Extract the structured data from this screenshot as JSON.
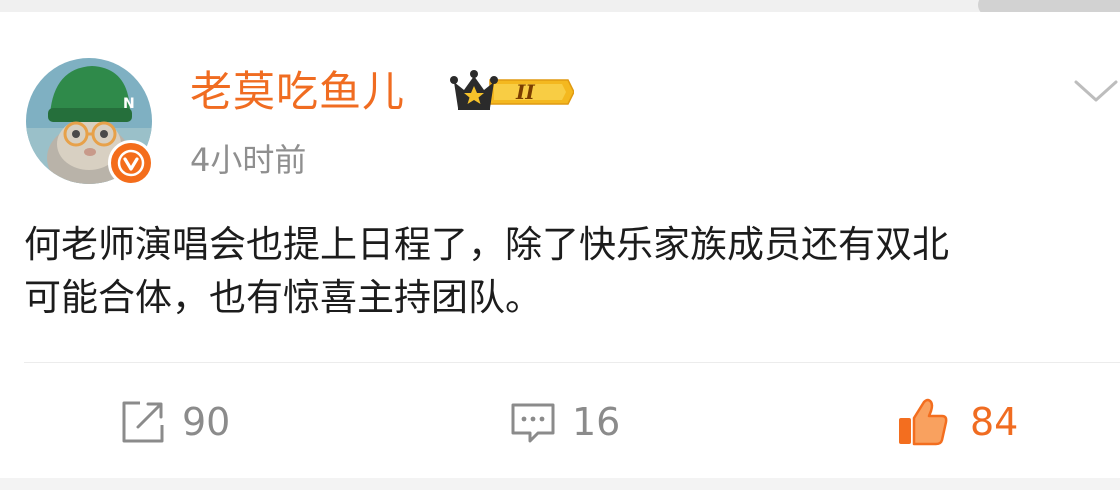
{
  "post": {
    "author": {
      "name": "老莫吃鱼儿",
      "vip_level": "II"
    },
    "time": "4小时前",
    "content_lines": [
      "何老师演唱会也提上日程了，除了快乐家族成员还有双北",
      "可能合体，也有惊喜主持团队。"
    ]
  },
  "actions": {
    "repost_count": "90",
    "comment_count": "16",
    "like_count": "84"
  },
  "icons": {
    "verified": "verified-v-badge",
    "vip": "crown-level-badge",
    "menu": "chevron-down",
    "repost": "share-arrow-box",
    "comment": "speech-bubble",
    "like": "thumbs-up"
  },
  "colors": {
    "brand_orange": "#f06c21",
    "muted_text": "#8b8b8b",
    "body_text": "#1c1c1c"
  }
}
